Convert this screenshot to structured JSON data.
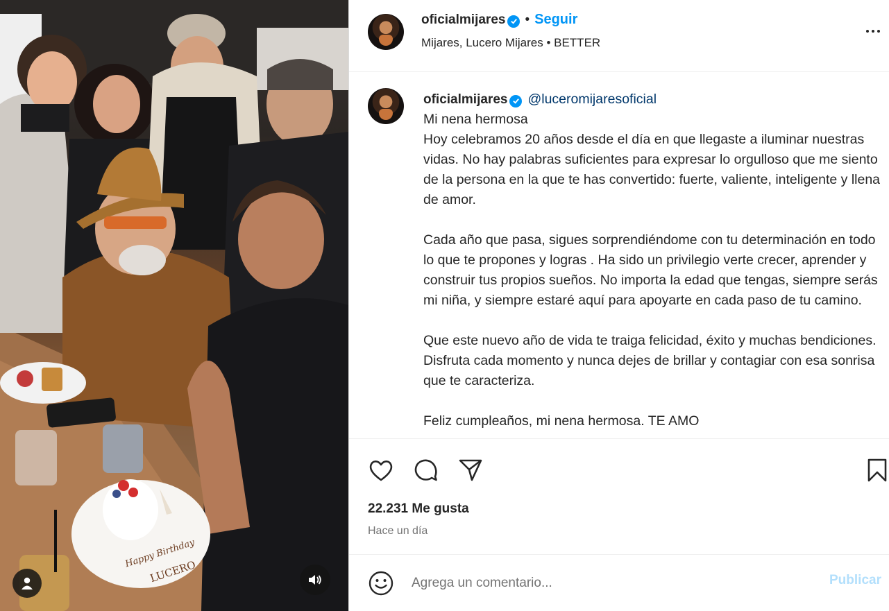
{
  "colors": {
    "accent": "#0095f6",
    "text": "#262626",
    "muted": "#737373",
    "publish_disabled": "#b2dffc"
  },
  "header": {
    "username": "oficialmijares",
    "separator": "•",
    "follow_label": "Seguir",
    "subtitle": "Mijares, Lucero Mijares • BETTER",
    "more_icon": "more-horizontal-icon"
  },
  "caption": {
    "username": "oficialmijares",
    "mention": "@luceromijaresoficial",
    "text": "Mi nena hermosa\nHoy celebramos 20 años desde el día en que llegaste a iluminar nuestras vidas. No hay palabras suficientes para expresar lo orgulloso que me siento de la persona en la que te has convertido: fuerte, valiente, inteligente y llena de amor.\n\nCada año que pasa, sigues sorprendiéndome con tu determinación en todo lo que te propones y logras . Ha sido un privilegio verte crecer, aprender y construir tus propios sueños. No importa la edad que tengas, siempre serás mi niña, y siempre estaré aquí para apoyarte en cada paso de tu camino.\n\nQue este nuevo año de vida te traiga felicidad, éxito y muchas bendiciones. Disfruta cada momento y nunca dejes de brillar y contagiar con esa sonrisa que te caracteriza.\n\nFeliz cumpleaños, mi nena hermosa. TE AMO"
  },
  "actions": {
    "like_icon": "heart-icon",
    "comment_icon": "comment-icon",
    "share_icon": "send-icon",
    "save_icon": "bookmark-icon"
  },
  "likes": "22.231 Me gusta",
  "time_ago": "Hace un día",
  "comment": {
    "placeholder": "Agrega un comentario...",
    "publish_label": "Publicar",
    "emoji_icon": "emoji-icon"
  },
  "photo": {
    "cake_text_1": "Happy Birthday",
    "cake_text_2": "LUCERO",
    "tag_icon": "user-tag-icon",
    "sound_icon": "sound-icon"
  }
}
